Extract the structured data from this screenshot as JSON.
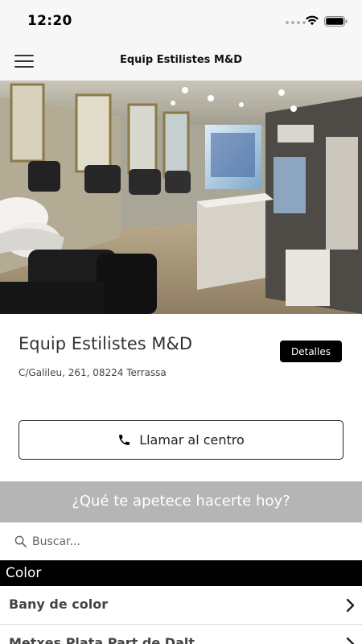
{
  "status_bar": {
    "time": "12:20"
  },
  "header": {
    "title": "Equip Estilistes M&D",
    "menu_icon": "hamburger-menu-icon"
  },
  "hero": {
    "carousel": {
      "slide_count": 3,
      "active_index": 0
    },
    "colors": {
      "active_dot": "#1e7fe0",
      "inactive_dot": "#9a9a9a"
    }
  },
  "salon": {
    "name": "Equip Estilistes M&D",
    "address": "C/Galileu, 261, 08224 Terrassa",
    "details_label": "Detalles"
  },
  "call": {
    "label": "Llamar al centro",
    "icon": "phone-icon"
  },
  "prompt": {
    "text": "¿Qué te apetece hacerte hoy?"
  },
  "search": {
    "placeholder": "Buscar...",
    "value": ""
  },
  "category": {
    "title": "Color",
    "items": [
      {
        "label": "Bany de color"
      },
      {
        "label": "Metxes Plata Part de Dalt"
      }
    ]
  }
}
